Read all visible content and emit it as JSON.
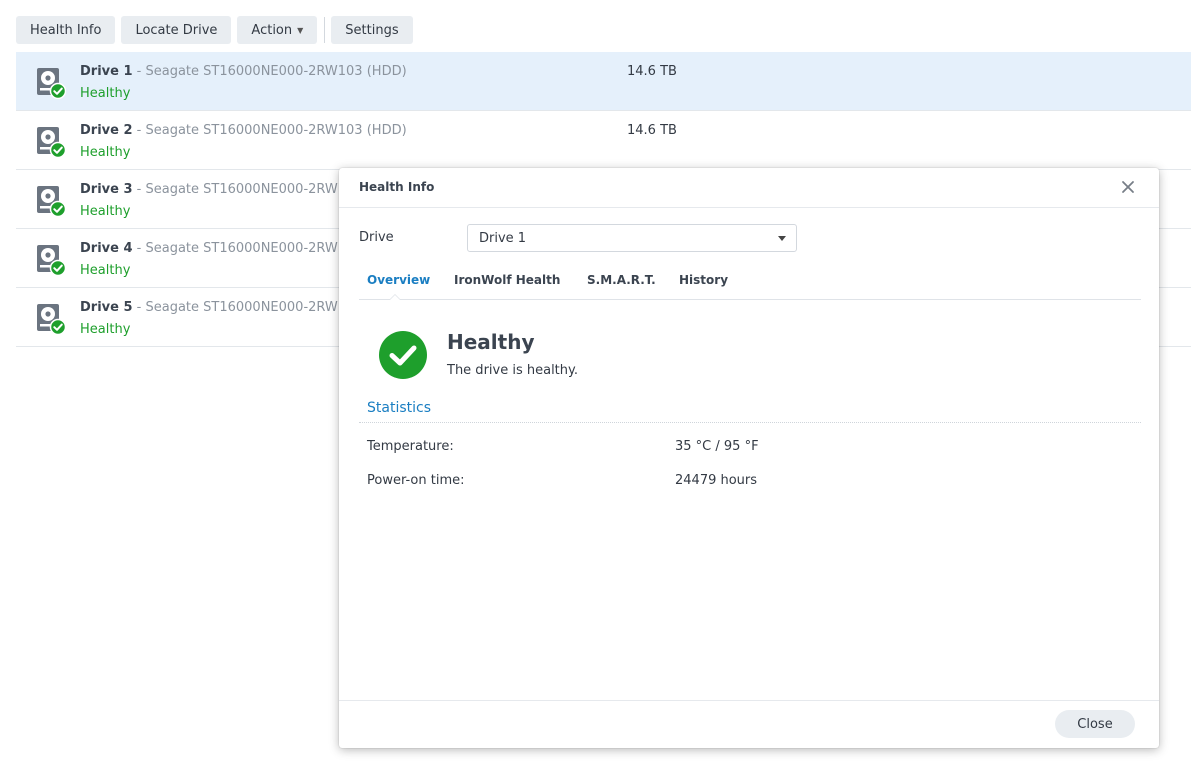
{
  "toolbar": {
    "health_info": "Health Info",
    "locate_drive": "Locate Drive",
    "action": "Action",
    "settings": "Settings"
  },
  "drives": [
    {
      "name": "Drive 1",
      "model": " - Seagate ST16000NE000-2RW103 (HDD)",
      "status": "Healthy",
      "size": "14.6 TB",
      "selected": true
    },
    {
      "name": "Drive 2",
      "model": " - Seagate ST16000NE000-2RW103 (HDD)",
      "status": "Healthy",
      "size": "14.6 TB",
      "selected": false
    },
    {
      "name": "Drive 3",
      "model": " - Seagate ST16000NE000-2RW",
      "status": "Healthy",
      "size": "",
      "selected": false
    },
    {
      "name": "Drive 4",
      "model": " - Seagate ST16000NE000-2RW",
      "status": "Healthy",
      "size": "",
      "selected": false
    },
    {
      "name": "Drive 5",
      "model": " - Seagate ST16000NE000-2RW",
      "status": "Healthy",
      "size": "",
      "selected": false
    }
  ],
  "modal": {
    "title": "Health Info",
    "drive_label": "Drive",
    "drive_selected": "Drive 1",
    "tabs": [
      "Overview",
      "IronWolf Health",
      "S.M.A.R.T.",
      "History"
    ],
    "active_tab": "Overview",
    "status_title": "Healthy",
    "status_desc": "The drive is healthy.",
    "section_title": "Statistics",
    "stats": [
      {
        "label": "Temperature:",
        "value": "35 °C / 95 °F"
      },
      {
        "label": "Power-on time:",
        "value": "24479 hours"
      }
    ],
    "close_label": "Close"
  },
  "colors": {
    "healthy_green": "#1e9f2c",
    "accent_blue": "#1a7ec2",
    "selected_row": "#e5f0fb"
  },
  "icons": {
    "drive": "hard-drive-icon",
    "status": "check-circle-icon",
    "close": "close-icon"
  }
}
